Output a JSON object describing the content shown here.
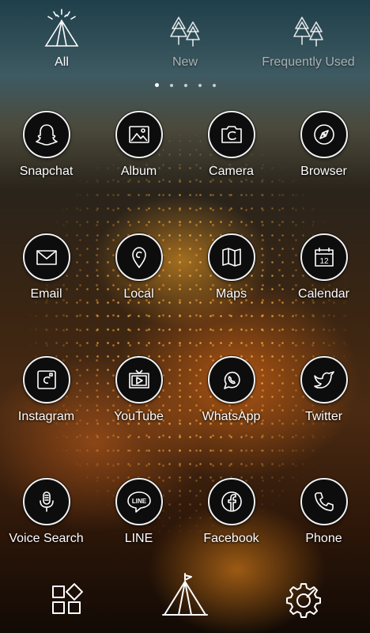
{
  "tabs": [
    {
      "label": "All",
      "icon": "tent-icon",
      "active": true
    },
    {
      "label": "New",
      "icon": "trees-icon",
      "active": false
    },
    {
      "label": "Frequently Used",
      "icon": "trees-icon",
      "active": false
    }
  ],
  "pager": {
    "count": 5,
    "active_index": 0
  },
  "apps": [
    {
      "label": "Snapchat",
      "icon": "ghost-icon"
    },
    {
      "label": "Album",
      "icon": "picture-icon"
    },
    {
      "label": "Camera",
      "icon": "camera-icon"
    },
    {
      "label": "Browser",
      "icon": "compass-icon"
    },
    {
      "label": "Email",
      "icon": "envelope-icon"
    },
    {
      "label": "Local",
      "icon": "map-pin-icon"
    },
    {
      "label": "Maps",
      "icon": "folded-map-icon"
    },
    {
      "label": "Calendar",
      "icon": "calendar-icon",
      "calendar_day": "12"
    },
    {
      "label": "Instagram",
      "icon": "instagram-icon"
    },
    {
      "label": "YouTube",
      "icon": "tv-play-icon"
    },
    {
      "label": "WhatsApp",
      "icon": "whatsapp-icon"
    },
    {
      "label": "Twitter",
      "icon": "bird-icon"
    },
    {
      "label": "Voice Search",
      "icon": "microphone-icon"
    },
    {
      "label": "LINE",
      "icon": "line-bubble-icon",
      "badge_text": "LINE"
    },
    {
      "label": "Facebook",
      "icon": "facebook-icon"
    },
    {
      "label": "Phone",
      "icon": "phone-icon"
    }
  ],
  "dock": [
    {
      "icon": "app-grid-icon"
    },
    {
      "icon": "tent-icon"
    },
    {
      "icon": "settings-gear-icon"
    }
  ],
  "colors": {
    "icon_bg": "#0d0d0d",
    "icon_ring": "#f1f1f1",
    "label": "#ffffff"
  }
}
